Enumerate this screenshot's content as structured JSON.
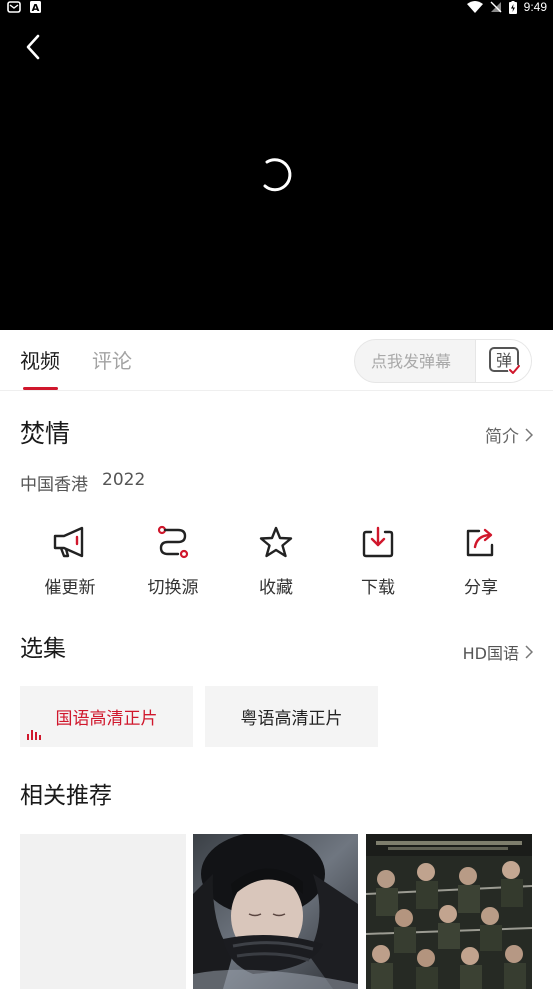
{
  "status_bar": {
    "time": "9:49",
    "left_icons": [
      "notification-icon",
      "app-a-icon"
    ],
    "right_icons": [
      "wifi-icon",
      "no-sim-icon",
      "battery-charging-icon"
    ]
  },
  "player": {
    "back_icon": "chevron-left-icon",
    "loading_icon": "spinner-icon"
  },
  "tabs": [
    {
      "label": "视频",
      "active": true
    },
    {
      "label": "评论",
      "active": false
    }
  ],
  "danmaku": {
    "placeholder": "点我发弹幕",
    "button_label": "弹"
  },
  "title": "焚情",
  "intro_link": "简介",
  "meta": {
    "region": "中国香港",
    "year": "2022"
  },
  "actions": [
    {
      "label": "催更新",
      "icon": "megaphone-icon"
    },
    {
      "label": "切换源",
      "icon": "switch-source-icon"
    },
    {
      "label": "收藏",
      "icon": "star-icon"
    },
    {
      "label": "下载",
      "icon": "download-icon"
    },
    {
      "label": "分享",
      "icon": "share-icon"
    }
  ],
  "episodes_section": {
    "title": "选集",
    "selector_label": "HD国语"
  },
  "episodes": [
    {
      "label": "国语高清正片",
      "active": true
    },
    {
      "label": "粤语高清正片",
      "active": false
    }
  ],
  "recommend": {
    "title": "相关推荐"
  },
  "colors": {
    "accent": "#d0172c",
    "player_bg": "#000000",
    "chip_bg": "#f4f4f4"
  }
}
